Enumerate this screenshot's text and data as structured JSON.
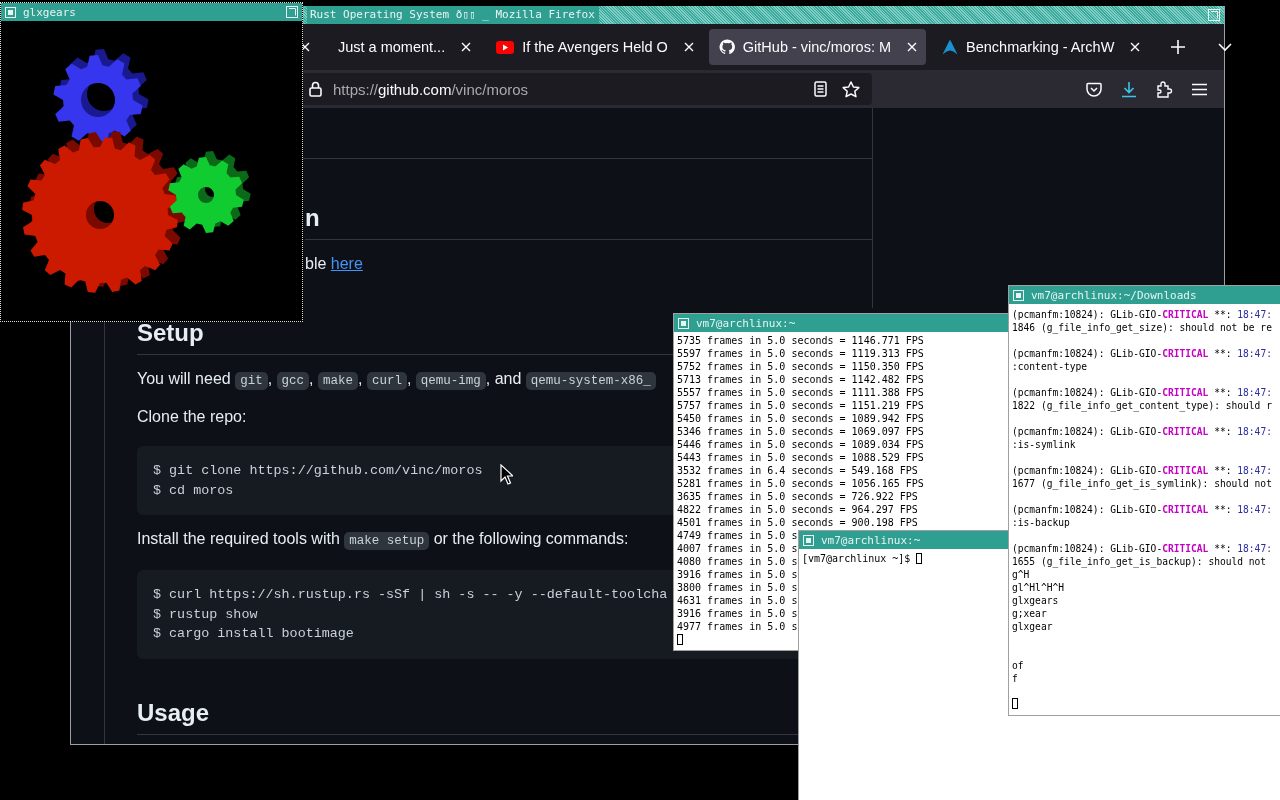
{
  "glxgears_window": {
    "title": "glxgears"
  },
  "browser_window": {
    "title": "Rust Operating System ð▯▯ _ Mozilla Firefox",
    "tabs": [
      {
        "label": "Just a moment...",
        "kind": "page",
        "selected": false
      },
      {
        "label": "If the Avengers Held O",
        "kind": "video",
        "selected": false
      },
      {
        "label": "GitHub - vinc/moros: M",
        "kind": "code_host",
        "selected": true
      },
      {
        "label": "Benchmarking - ArchW",
        "kind": "wiki",
        "selected": false
      }
    ],
    "address_bar": {
      "scheme": "https://",
      "host": "github.com",
      "path": "/vinc/moros"
    },
    "readme": [
      {
        "kind": "clipped_heading",
        "text": "n"
      },
      {
        "kind": "clipped_paragraph",
        "parts": [
          {
            "kind": "text",
            "text": "ble "
          },
          {
            "kind": "link",
            "text": "here"
          }
        ]
      },
      {
        "kind": "heading",
        "text": "Setup"
      },
      {
        "kind": "paragraph",
        "parts": [
          {
            "kind": "text",
            "text": "You will need "
          },
          {
            "kind": "code",
            "text": "git"
          },
          {
            "kind": "text",
            "text": ", "
          },
          {
            "kind": "code",
            "text": "gcc"
          },
          {
            "kind": "text",
            "text": ", "
          },
          {
            "kind": "code",
            "text": "make"
          },
          {
            "kind": "text",
            "text": ", "
          },
          {
            "kind": "code",
            "text": "curl"
          },
          {
            "kind": "text",
            "text": ", "
          },
          {
            "kind": "code",
            "text": "qemu-img"
          },
          {
            "kind": "text",
            "text": ", and "
          },
          {
            "kind": "code",
            "text": "qemu-system-x86_"
          }
        ]
      },
      {
        "kind": "paragraph",
        "parts": [
          {
            "kind": "text",
            "text": "Clone the repo:"
          }
        ]
      },
      {
        "kind": "code_block",
        "lines": [
          "$ git clone https://github.com/vinc/moros",
          "$ cd moros"
        ]
      },
      {
        "kind": "paragraph",
        "parts": [
          {
            "kind": "text",
            "text": "Install the required tools with "
          },
          {
            "kind": "code",
            "text": "make setup"
          },
          {
            "kind": "text",
            "text": " or the following commands:"
          }
        ]
      },
      {
        "kind": "code_block",
        "lines": [
          "$ curl https://sh.rustup.rs -sSf | sh -s -- -y --default-toolcha",
          "$ rustup show",
          "$ cargo install bootimage"
        ]
      },
      {
        "kind": "heading",
        "text": "Usage"
      }
    ]
  },
  "terminals": [
    {
      "title": "vm7@archlinux:~",
      "lines": [
        {
          "kind": "text",
          "parts": [
            {
              "kind": "plain",
              "text": "5735 frames in 5.0 seconds = 1146.771 FPS"
            }
          ]
        },
        {
          "kind": "text",
          "parts": [
            {
              "kind": "plain",
              "text": "5597 frames in 5.0 seconds = 1119.313 FPS"
            }
          ]
        },
        {
          "kind": "text",
          "parts": [
            {
              "kind": "plain",
              "text": "5752 frames in 5.0 seconds = 1150.350 FPS"
            }
          ]
        },
        {
          "kind": "text",
          "parts": [
            {
              "kind": "plain",
              "text": "5713 frames in 5.0 seconds = 1142.482 FPS"
            }
          ]
        },
        {
          "kind": "text",
          "parts": [
            {
              "kind": "plain",
              "text": "5557 frames in 5.0 seconds = 1111.388 FPS"
            }
          ]
        },
        {
          "kind": "text",
          "parts": [
            {
              "kind": "plain",
              "text": "5757 frames in 5.0 seconds = 1151.219 FPS"
            }
          ]
        },
        {
          "kind": "text",
          "parts": [
            {
              "kind": "plain",
              "text": "5450 frames in 5.0 seconds = 1089.942 FPS"
            }
          ]
        },
        {
          "kind": "text",
          "parts": [
            {
              "kind": "plain",
              "text": "5346 frames in 5.0 seconds = 1069.097 FPS"
            }
          ]
        },
        {
          "kind": "text",
          "parts": [
            {
              "kind": "plain",
              "text": "5446 frames in 5.0 seconds = 1089.034 FPS"
            }
          ]
        },
        {
          "kind": "text",
          "parts": [
            {
              "kind": "plain",
              "text": "5443 frames in 5.0 seconds = 1088.529 FPS"
            }
          ]
        },
        {
          "kind": "text",
          "parts": [
            {
              "kind": "plain",
              "text": "3532 frames in 6.4 seconds = 549.168 FPS"
            }
          ]
        },
        {
          "kind": "text",
          "parts": [
            {
              "kind": "plain",
              "text": "5281 frames in 5.0 seconds = 1056.165 FPS"
            }
          ]
        },
        {
          "kind": "text",
          "parts": [
            {
              "kind": "plain",
              "text": "3635 frames in 5.0 seconds = 726.922 FPS"
            }
          ]
        },
        {
          "kind": "text",
          "parts": [
            {
              "kind": "plain",
              "text": "4822 frames in 5.0 seconds = 964.297 FPS"
            }
          ]
        },
        {
          "kind": "text",
          "parts": [
            {
              "kind": "plain",
              "text": "4501 frames in 5.0 seconds = 900.198 FPS"
            }
          ]
        },
        {
          "kind": "text",
          "parts": [
            {
              "kind": "plain",
              "text": "4749 frames in 5.0 s"
            }
          ]
        },
        {
          "kind": "text",
          "parts": [
            {
              "kind": "plain",
              "text": "4007 frames in 5.0 s"
            }
          ]
        },
        {
          "kind": "text",
          "parts": [
            {
              "kind": "plain",
              "text": "4080 frames in 5.0 s"
            }
          ]
        },
        {
          "kind": "text",
          "parts": [
            {
              "kind": "plain",
              "text": "3916 frames in 5.0 s"
            }
          ]
        },
        {
          "kind": "text",
          "parts": [
            {
              "kind": "plain",
              "text": "3800 frames in 5.0 s"
            }
          ]
        },
        {
          "kind": "text",
          "parts": [
            {
              "kind": "plain",
              "text": "4631 frames in 5.0 s"
            }
          ]
        },
        {
          "kind": "text",
          "parts": [
            {
              "kind": "plain",
              "text": "3916 frames in 5.0 s"
            }
          ]
        },
        {
          "kind": "text",
          "parts": [
            {
              "kind": "plain",
              "text": "4977 frames in 5.0 s"
            }
          ]
        },
        {
          "kind": "text",
          "parts": [
            {
              "kind": "cursor"
            }
          ]
        }
      ]
    },
    {
      "title": "vm7@archlinux:~",
      "lines": [
        {
          "kind": "text",
          "parts": [
            {
              "kind": "plain",
              "text": "[vm7@archlinux ~]$ "
            },
            {
              "kind": "cursor"
            }
          ]
        }
      ]
    },
    {
      "title": "vm7@archlinux:~/Downloads",
      "lines": [
        {
          "kind": "text",
          "parts": [
            {
              "kind": "plain",
              "text": "(pcmanfm:10824): GLib-GIO-"
            },
            {
              "kind": "critical",
              "text": "CRITICAL"
            },
            {
              "kind": "plain",
              "text": " **: "
            },
            {
              "kind": "time",
              "text": "18:47:"
            }
          ]
        },
        {
          "kind": "text",
          "parts": [
            {
              "kind": "plain",
              "text": "1846 (g_file_info_get_size): should not be re"
            }
          ]
        },
        {
          "kind": "blank"
        },
        {
          "kind": "text",
          "parts": [
            {
              "kind": "plain",
              "text": "(pcmanfm:10824): GLib-GIO-"
            },
            {
              "kind": "critical",
              "text": "CRITICAL"
            },
            {
              "kind": "plain",
              "text": " **: "
            },
            {
              "kind": "time",
              "text": "18:47:"
            }
          ]
        },
        {
          "kind": "text",
          "parts": [
            {
              "kind": "plain",
              "text": ":content-type"
            }
          ]
        },
        {
          "kind": "blank"
        },
        {
          "kind": "text",
          "parts": [
            {
              "kind": "plain",
              "text": "(pcmanfm:10824): GLib-GIO-"
            },
            {
              "kind": "critical",
              "text": "CRITICAL"
            },
            {
              "kind": "plain",
              "text": " **: "
            },
            {
              "kind": "time",
              "text": "18:47:"
            }
          ]
        },
        {
          "kind": "text",
          "parts": [
            {
              "kind": "plain",
              "text": "1822 (g_file_info_get_content_type): should r"
            }
          ]
        },
        {
          "kind": "blank"
        },
        {
          "kind": "text",
          "parts": [
            {
              "kind": "plain",
              "text": "(pcmanfm:10824): GLib-GIO-"
            },
            {
              "kind": "critical",
              "text": "CRITICAL"
            },
            {
              "kind": "plain",
              "text": " **: "
            },
            {
              "kind": "time",
              "text": "18:47:"
            }
          ]
        },
        {
          "kind": "text",
          "parts": [
            {
              "kind": "plain",
              "text": ":is-symlink"
            }
          ]
        },
        {
          "kind": "blank"
        },
        {
          "kind": "text",
          "parts": [
            {
              "kind": "plain",
              "text": "(pcmanfm:10824): GLib-GIO-"
            },
            {
              "kind": "critical",
              "text": "CRITICAL"
            },
            {
              "kind": "plain",
              "text": " **: "
            },
            {
              "kind": "time",
              "text": "18:47:"
            }
          ]
        },
        {
          "kind": "text",
          "parts": [
            {
              "kind": "plain",
              "text": "1677 (g_file_info_get_is_symlink): should not"
            }
          ]
        },
        {
          "kind": "blank"
        },
        {
          "kind": "text",
          "parts": [
            {
              "kind": "plain",
              "text": "(pcmanfm:10824): GLib-GIO-"
            },
            {
              "kind": "critical",
              "text": "CRITICAL"
            },
            {
              "kind": "plain",
              "text": " **: "
            },
            {
              "kind": "time",
              "text": "18:47:"
            }
          ]
        },
        {
          "kind": "text",
          "parts": [
            {
              "kind": "plain",
              "text": ":is-backup"
            }
          ]
        },
        {
          "kind": "blank"
        },
        {
          "kind": "text",
          "parts": [
            {
              "kind": "plain",
              "text": "(pcmanfm:10824): GLib-GIO-"
            },
            {
              "kind": "critical",
              "text": "CRITICAL"
            },
            {
              "kind": "plain",
              "text": " **: "
            },
            {
              "kind": "time",
              "text": "18:47:"
            }
          ]
        },
        {
          "kind": "text",
          "parts": [
            {
              "kind": "plain",
              "text": "1655 (g_file_info_get_is_backup): should not"
            }
          ]
        },
        {
          "kind": "text",
          "parts": [
            {
              "kind": "plain",
              "text": "g^H"
            }
          ]
        },
        {
          "kind": "text",
          "parts": [
            {
              "kind": "plain",
              "text": "gl^Hl^H^H"
            }
          ]
        },
        {
          "kind": "text",
          "parts": [
            {
              "kind": "plain",
              "text": "glxgears"
            }
          ]
        },
        {
          "kind": "text",
          "parts": [
            {
              "kind": "plain",
              "text": "g;xear"
            }
          ]
        },
        {
          "kind": "text",
          "parts": [
            {
              "kind": "plain",
              "text": "glxgear"
            }
          ]
        },
        {
          "kind": "blank"
        },
        {
          "kind": "blank"
        },
        {
          "kind": "text",
          "parts": [
            {
              "kind": "plain",
              "text": "of"
            }
          ]
        },
        {
          "kind": "text",
          "parts": [
            {
              "kind": "plain",
              "text": "f"
            }
          ]
        },
        {
          "kind": "blank"
        },
        {
          "kind": "text",
          "parts": [
            {
              "kind": "cursor"
            }
          ]
        }
      ]
    }
  ]
}
